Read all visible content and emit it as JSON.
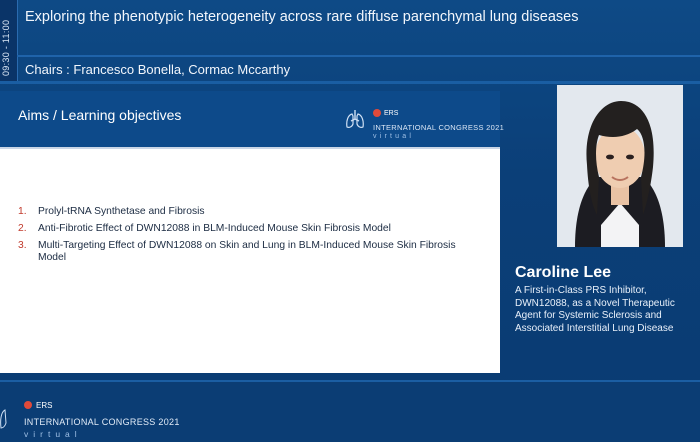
{
  "session": {
    "time": "09:30 - 11:00",
    "title": "Exploring the phenotypic heterogeneity across rare diffuse parenchymal lung diseases",
    "chairs": "Chairs : Francesco Bonella, Cormac Mccarthy"
  },
  "slide": {
    "title": "Aims / Learning objectives",
    "brand": {
      "badge": "ERS",
      "congress": "INTERNATIONAL CONGRESS 2021",
      "virtual": "virtual",
      "icon": "lung-icon"
    },
    "objectives": [
      {
        "num": "1.",
        "text": "Prolyl-tRNA Synthetase and Fibrosis"
      },
      {
        "num": "2.",
        "text": "Anti-Fibrotic Effect of DWN12088 in BLM-Induced Mouse Skin Fibrosis Model"
      },
      {
        "num": "3.",
        "text": "Multi-Targeting Effect of DWN12088 on Skin and Lung in BLM-Induced Mouse Skin Fibrosis Model"
      }
    ],
    "number_color": "#c0392b"
  },
  "speaker": {
    "name": "Caroline Lee",
    "talk": "A First-in-Class PRS Inhibitor, DWN12088, as a Novel Therapeutic Agent for Systemic Sclerosis and Associated Interstitial Lung Disease"
  },
  "footer": {
    "badge": "ERS",
    "congress": "INTERNATIONAL CONGRESS 2021",
    "virtual": "virtual"
  },
  "colors": {
    "background": "#0b3d74",
    "slide_header": "#0d4a8a",
    "accent_red": "#e04a3a"
  }
}
